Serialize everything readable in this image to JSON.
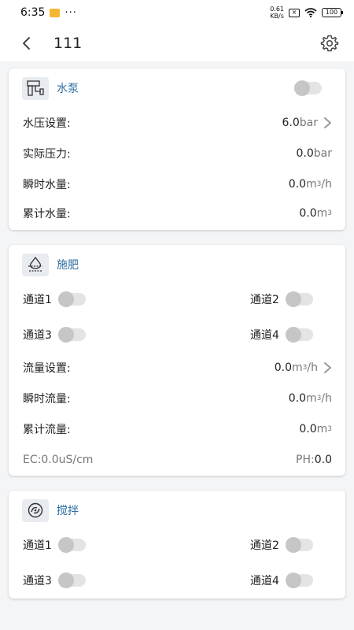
{
  "status_bar": {
    "time": "6:35",
    "dots": "···",
    "net_speed_top": "0.61",
    "net_speed_bottom": "KB/s",
    "battery": "100"
  },
  "header": {
    "title": "111"
  },
  "pump": {
    "title": "水泵",
    "pressure_setting": {
      "label": "水压设置:",
      "value": "6.0",
      "unit": "bar"
    },
    "actual_pressure": {
      "label": "实际压力:",
      "value": "0.0",
      "unit": "bar"
    },
    "instant_water": {
      "label": "瞬时水量:",
      "value": "0.0",
      "unit": "m",
      "sup": "3",
      "unit_suffix": "/h"
    },
    "total_water": {
      "label": "累计水量:",
      "value": "0.0",
      "unit": "m",
      "sup": "3"
    }
  },
  "fertilize": {
    "title": "施肥",
    "channels": [
      "通道1",
      "通道2",
      "通道3",
      "通道4"
    ],
    "flow_setting": {
      "label": "流量设置:",
      "value": "0.0",
      "unit": "m",
      "sup": "3",
      "unit_suffix": "/h"
    },
    "instant_flow": {
      "label": "瞬时流量:",
      "value": "0.0",
      "unit": "m",
      "sup": "3",
      "unit_suffix": "/h"
    },
    "total_flow": {
      "label": "累计流量:",
      "value": "0.0",
      "unit": "m",
      "sup": "3"
    },
    "ec": "EC:0.0uS/cm",
    "ph_label": "PH:",
    "ph_value": "0.0"
  },
  "stir": {
    "title": "搅拌",
    "channels": [
      "通道1",
      "通道2",
      "通道3",
      "通道4"
    ]
  }
}
